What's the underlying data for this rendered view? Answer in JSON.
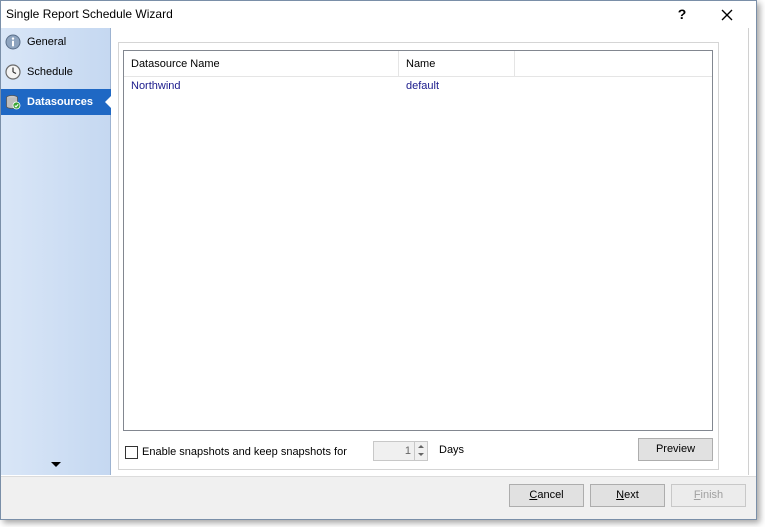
{
  "window": {
    "title": "Single Report Schedule Wizard",
    "help_label": "?",
    "close_label": "✕"
  },
  "sidebar": {
    "items": [
      {
        "label": "General",
        "icon": "info-icon"
      },
      {
        "label": "Schedule",
        "icon": "clock-icon"
      },
      {
        "label": "Datasources",
        "icon": "database-icon",
        "active": true
      }
    ]
  },
  "grid": {
    "columns": [
      "Datasource Name",
      "Name"
    ],
    "rows": [
      {
        "datasource_name": "Northwind",
        "name": "default"
      }
    ]
  },
  "snapshots": {
    "checked": false,
    "label": "Enable snapshots and keep snapshots for",
    "value": "1",
    "unit": "Days"
  },
  "buttons": {
    "preview": "Preview",
    "cancel_prefix": "",
    "cancel_u": "C",
    "cancel_rest": "ancel",
    "next_u": "N",
    "next_rest": "ext",
    "finish_u": "F",
    "finish_rest": "inish"
  },
  "colors": {
    "active_nav": "#1f68c4",
    "sidebar_light": "#d9e6f7",
    "row_text": "#1a1a8c"
  }
}
